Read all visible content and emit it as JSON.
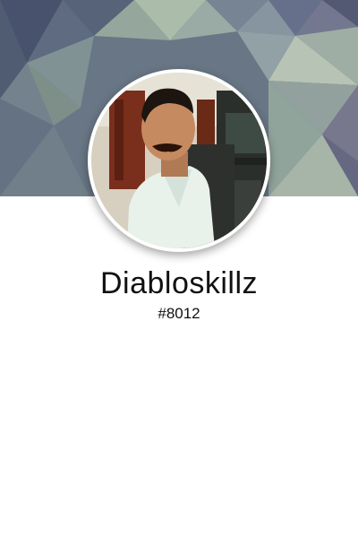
{
  "profile": {
    "username": "Diabloskillz",
    "discriminator": "#8012"
  },
  "colors": {
    "banner_base": "#5f6e7e",
    "banner_dark": "#3e4a60",
    "banner_light": "#a7b9a9",
    "ring": "#ffffff",
    "text": "#111111",
    "background": "#ffffff"
  },
  "icons": {
    "avatar": "user-photo"
  }
}
